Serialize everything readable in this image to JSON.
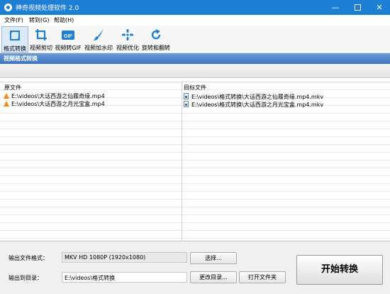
{
  "window": {
    "title": "神奇视频处理软件 2.0",
    "minimize": "—",
    "close": "✕",
    "title_color": "#1f7fd4"
  },
  "menu": [
    "文件(F)",
    "转到(G)",
    "帮助(H)"
  ],
  "toolbar": [
    {
      "label": "格式转换",
      "icon": "format-convert-icon",
      "active": true
    },
    {
      "label": "视频剪切",
      "icon": "crop-icon",
      "active": false
    },
    {
      "label": "视频转GIF",
      "icon": "gif-icon",
      "gif_text": "GIF",
      "active": false
    },
    {
      "label": "视频加水印",
      "icon": "brush-icon",
      "active": false
    },
    {
      "label": "视频优化",
      "icon": "optimize-icon",
      "active": false
    },
    {
      "label": "旋转和翻转",
      "icon": "rotate-icon",
      "active": false
    }
  ],
  "section_title": "视频格式转换",
  "grid": {
    "col_source": "原文件",
    "col_target": "目标文件",
    "rows": [
      {
        "source": "E:\\videos\\大话西游之仙履奇缘.mp4",
        "target": "E:\\videos\\格式转换\\大话西游之仙履奇缘.mp4.mkv"
      },
      {
        "source": "E:\\videos\\大话西游之月光宝盒.mp4",
        "target": "E:\\videos\\格式转换\\大话西游之月光宝盒.mp4.mkv"
      }
    ]
  },
  "bottom": {
    "output_format_label": "输出文件格式：",
    "output_format_value": "MKV HD 1080P (1920x1080)",
    "choose_button": "选择...",
    "output_dir_label": "输出到目录：",
    "output_dir_value": "E:\\videos\\格式转换",
    "change_dir_button": "更改目录...",
    "open_folder_button": "打开文件夹",
    "start_button": "开始转换"
  }
}
